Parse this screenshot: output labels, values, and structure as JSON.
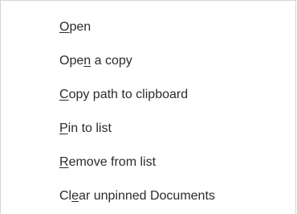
{
  "menu": {
    "items": [
      {
        "pre": "",
        "acc": "O",
        "post": "pen"
      },
      {
        "pre": "Ope",
        "acc": "n",
        "post": " a copy"
      },
      {
        "pre": "",
        "acc": "C",
        "post": "opy path to clipboard"
      },
      {
        "pre": "",
        "acc": "P",
        "post": "in to list"
      },
      {
        "pre": "",
        "acc": "R",
        "post": "emove from list"
      },
      {
        "pre": "Cl",
        "acc": "e",
        "post": "ar unpinned Documents"
      }
    ]
  }
}
